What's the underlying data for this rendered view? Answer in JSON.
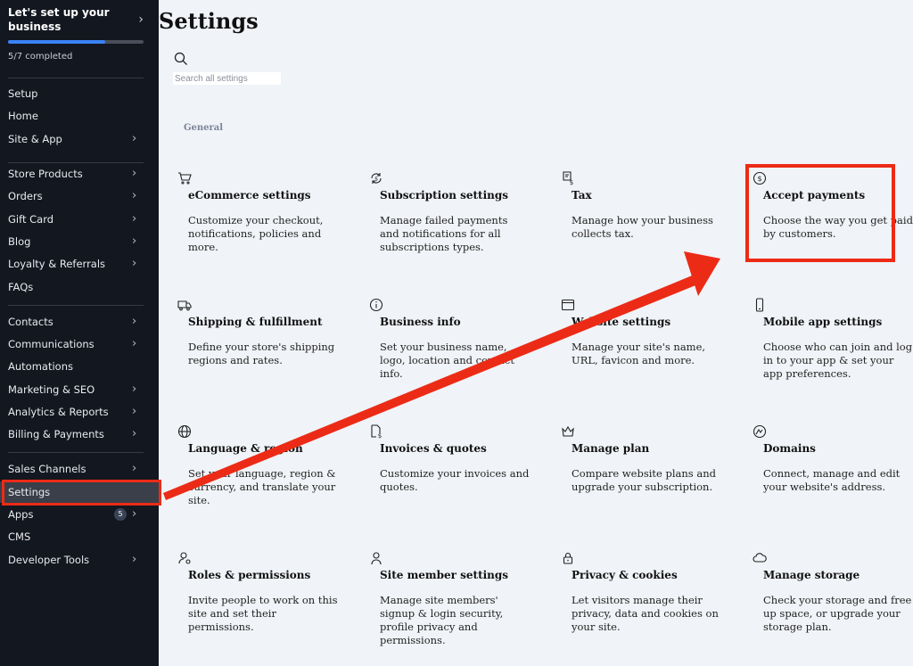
{
  "setup": {
    "title": "Let's set up your business",
    "progress_text": "5/7 completed",
    "progress": 0.714
  },
  "sidebar": {
    "items": [
      {
        "label": "Setup",
        "chevron": false
      },
      {
        "label": "Home",
        "chevron": false
      },
      {
        "label": "Site & App",
        "chevron": true
      },
      {
        "label": "Store Products",
        "chevron": true
      },
      {
        "label": "Orders",
        "chevron": true
      },
      {
        "label": "Gift Card",
        "chevron": true
      },
      {
        "label": "Blog",
        "chevron": true
      },
      {
        "label": "Loyalty & Referrals",
        "chevron": true
      },
      {
        "label": "FAQs",
        "chevron": false
      },
      {
        "label": "Contacts",
        "chevron": true
      },
      {
        "label": "Communications",
        "chevron": true
      },
      {
        "label": "Automations",
        "chevron": false
      },
      {
        "label": "Marketing & SEO",
        "chevron": true
      },
      {
        "label": "Analytics & Reports",
        "chevron": true
      },
      {
        "label": "Billing & Payments",
        "chevron": true
      },
      {
        "label": "Sales Channels",
        "chevron": true
      },
      {
        "label": "Settings",
        "chevron": false,
        "active": true
      },
      {
        "label": "Apps",
        "chevron": true,
        "badge": "5"
      },
      {
        "label": "CMS",
        "chevron": false
      },
      {
        "label": "Developer Tools",
        "chevron": true
      }
    ]
  },
  "page": {
    "title": "Settings",
    "search_placeholder": "Search all settings",
    "section": "General"
  },
  "cards": [
    {
      "icon": "cart-icon",
      "title": "eCommerce settings",
      "desc": "Customize your checkout, notifications, policies and more."
    },
    {
      "icon": "subscription-icon",
      "title": "Subscription settings",
      "desc": "Manage failed payments and notifications for all subscriptions types."
    },
    {
      "icon": "tax-receipt-icon",
      "title": "Tax",
      "desc": "Manage how your business collects tax."
    },
    {
      "icon": "dollar-coin-icon",
      "title": "Accept payments",
      "desc": "Choose the way you get paid by customers."
    },
    {
      "icon": "truck-icon",
      "title": "Shipping & fulfillment",
      "desc": "Define your store's shipping regions and rates."
    },
    {
      "icon": "info-icon",
      "title": "Business info",
      "desc": "Set your business name, logo, location and contact info."
    },
    {
      "icon": "browser-window-icon",
      "title": "Website settings",
      "desc": "Manage your site's name, URL, favicon and more."
    },
    {
      "icon": "mobile-icon",
      "title": "Mobile app settings",
      "desc": "Choose who can join and log in to your app & set your app preferences."
    },
    {
      "icon": "globe-icon",
      "title": "Language & region",
      "desc": "Set your language, region & currency, and translate your site."
    },
    {
      "icon": "invoice-icon",
      "title": "Invoices & quotes",
      "desc": "Customize your invoices and quotes."
    },
    {
      "icon": "crown-icon",
      "title": "Manage plan",
      "desc": "Compare website plans and upgrade your subscription."
    },
    {
      "icon": "domain-icon",
      "title": "Domains",
      "desc": "Connect, manage and edit your website's address."
    },
    {
      "icon": "user-key-icon",
      "title": "Roles & permissions",
      "desc": "Invite people to work on this site and set their permissions."
    },
    {
      "icon": "person-icon",
      "title": "Site member settings",
      "desc": "Manage site members' signup & login security, profile privacy and permissions."
    },
    {
      "icon": "lock-icon",
      "title": "Privacy & cookies",
      "desc": "Let visitors manage their privacy, data and cookies on your site."
    },
    {
      "icon": "cloud-icon",
      "title": "Manage storage",
      "desc": "Check your storage and free up space, or upgrade your storage plan."
    }
  ],
  "colors": {
    "sidebar_bg": "#131720",
    "main_bg": "#f0f3f7",
    "annotation_red": "#ec2b17",
    "progress": "#3b82f6"
  }
}
